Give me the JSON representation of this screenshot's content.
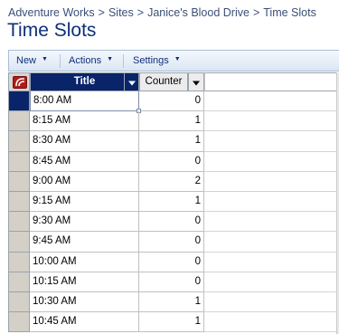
{
  "breadcrumb": {
    "items": [
      "Adventure Works",
      "Sites",
      "Janice's Blood Drive",
      "Time Slots"
    ],
    "separator": ">"
  },
  "page_title": "Time Slots",
  "toolbar": {
    "new_label": "New",
    "actions_label": "Actions",
    "settings_label": "Settings"
  },
  "grid": {
    "columns": {
      "title": "Title",
      "counter": "Counter"
    },
    "rows": [
      {
        "title": "8:00 AM",
        "counter": "0"
      },
      {
        "title": "8:15 AM",
        "counter": "1"
      },
      {
        "title": "8:30 AM",
        "counter": "1"
      },
      {
        "title": "8:45 AM",
        "counter": "0"
      },
      {
        "title": "9:00 AM",
        "counter": "2"
      },
      {
        "title": "9:15 AM",
        "counter": "1"
      },
      {
        "title": "9:30 AM",
        "counter": "0"
      },
      {
        "title": "9:45 AM",
        "counter": "0"
      },
      {
        "title": "10:00 AM",
        "counter": "0"
      },
      {
        "title": "10:15 AM",
        "counter": "0"
      },
      {
        "title": "10:30 AM",
        "counter": "1"
      },
      {
        "title": "10:45 AM",
        "counter": "1"
      }
    ]
  },
  "colors": {
    "header_active": "#0a246a",
    "title_blue": "#0d2f7a",
    "breadcrumb_blue": "#3a4f78"
  }
}
